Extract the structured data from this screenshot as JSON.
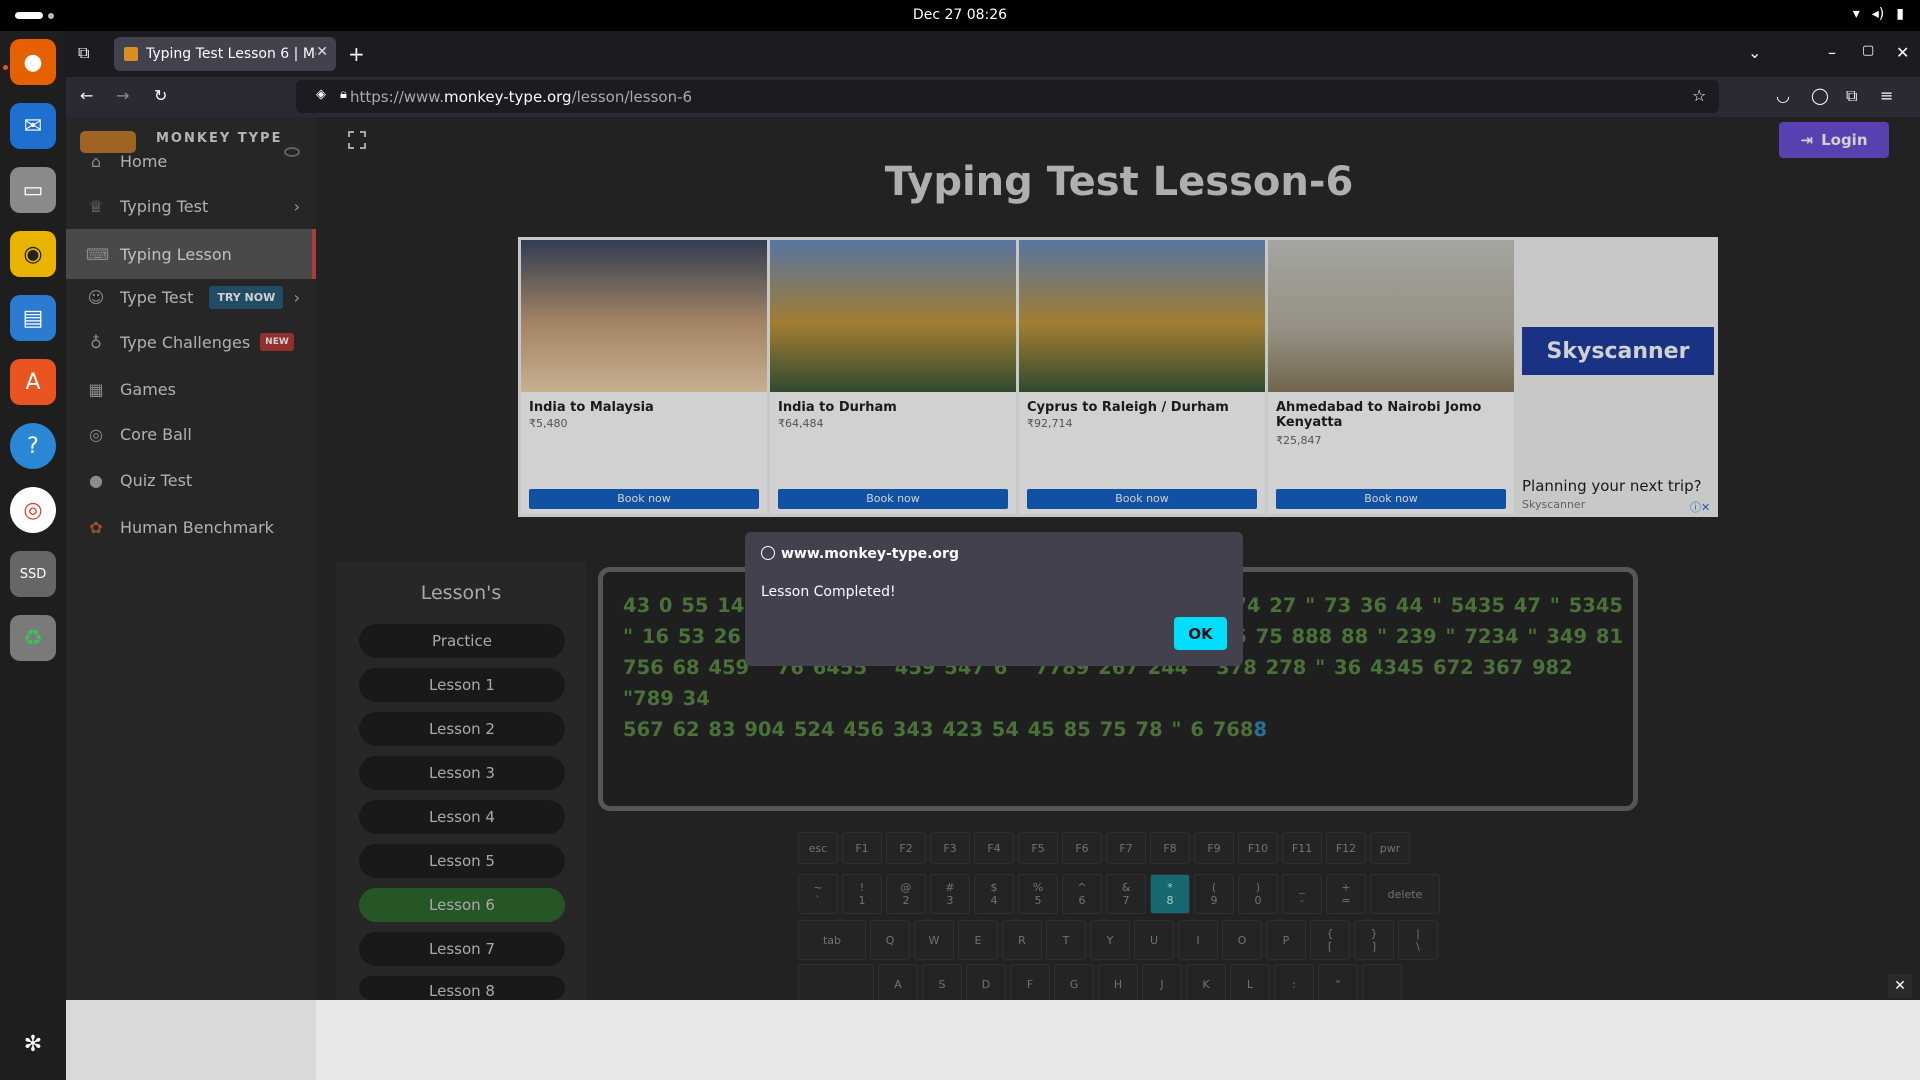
{
  "system": {
    "clock": "Dec 27  08:26"
  },
  "browser": {
    "tab_title": "Typing Test Lesson 6 | Mo",
    "url_prefix": "https://www.",
    "url_domain": "monkey-type.org",
    "url_path": "/lesson/lesson-6"
  },
  "sidebar": {
    "brand": "MONKEY TYPE",
    "items": [
      {
        "label": "Home",
        "icon": "home-icon"
      },
      {
        "label": "Typing Test",
        "icon": "trophy-icon"
      },
      {
        "label": "Typing Lesson",
        "icon": "keyboard-icon"
      },
      {
        "label": "Type Test",
        "icon": "cat-icon",
        "badge": "TRY NOW"
      },
      {
        "label": "Type Challenges",
        "icon": "award-icon",
        "badge": "NEW"
      },
      {
        "label": "Games",
        "icon": "grid-icon"
      },
      {
        "label": "Core Ball",
        "icon": "target-icon"
      },
      {
        "label": "Quiz Test",
        "icon": "quiz-icon"
      },
      {
        "label": "Human Benchmark",
        "icon": "brain-icon"
      }
    ]
  },
  "header": {
    "login_label": "Login",
    "title": "Typing Test Lesson-6"
  },
  "ad": {
    "cards": [
      {
        "name": "India to Malaysia",
        "price": "₹5,480",
        "cta": "Book now"
      },
      {
        "name": "India to Durham",
        "price": "₹64,484",
        "cta": "Book now"
      },
      {
        "name": "Cyprus to Raleigh / Durham",
        "price": "₹92,714",
        "cta": "Book now"
      },
      {
        "name": "Ahmedabad to Nairobi Jomo Kenyatta",
        "price": "₹25,847",
        "cta": "Book now"
      }
    ],
    "brand": "Skyscanner",
    "tagline": "Planning your next trip?",
    "small": "Skyscanner"
  },
  "lessons": {
    "title": "Lesson's",
    "items": [
      "Practice",
      "Lesson 1",
      "Lesson 2",
      "Lesson 3",
      "Lesson 4",
      "Lesson 5",
      "Lesson 6",
      "Lesson 7",
      "Lesson 8"
    ],
    "active_index": 6
  },
  "typing_text": {
    "line1": "43 0 55 14 ",
    "line1_right": "74 27 \" 73 36 44 \" 5435 47 \" 5345",
    "line2": "\" 16 53 26 ",
    "line2_right": "5 75 888 88 \" 239 \" 7234 \" 349 81",
    "line3": "756 68 459 \" 76 6455 \" 459 547 6 \" 7789 267 244 \" 378 278 \" 36 4345 672 367 982 \"789 34",
    "line4": "567 62 83 904 524 456 343 423 54 45 85 75 78 \" 6 768",
    "caret_char": "8"
  },
  "keyboard": {
    "fn_row": [
      "esc",
      "F1",
      "F2",
      "F3",
      "F4",
      "F5",
      "F6",
      "F7",
      "F8",
      "F9",
      "F10",
      "F11",
      "F12",
      "pwr"
    ],
    "num_row": [
      "~\n`",
      "!\n1",
      "@\n2",
      "#\n3",
      "$\n4",
      "%\n5",
      "^\n6",
      "&\n7",
      "*\n8",
      "(\n9",
      ")\n0",
      "_\n-",
      "+\n=",
      "delete"
    ],
    "top_row": [
      "tab",
      "Q",
      "W",
      "E",
      "R",
      "T",
      "Y",
      "U",
      "I",
      "O",
      "P",
      "{\n[",
      "}\n]",
      "|\n\\"
    ],
    "home_row": [
      "",
      "A",
      "S",
      "D",
      "F",
      "G",
      "H",
      "J",
      "K",
      "L",
      ":",
      "\"",
      ""
    ],
    "highlight_color": "#1c7f8a"
  },
  "dialog": {
    "origin": "www.monkey-type.org",
    "message": "Lesson Completed!",
    "ok_label": "OK"
  },
  "colors": {
    "login": "#6c4fd8",
    "active_lesson": "#2f6a2f",
    "text_green": "#5a8a46",
    "dialog_ok": "#00ddff"
  }
}
